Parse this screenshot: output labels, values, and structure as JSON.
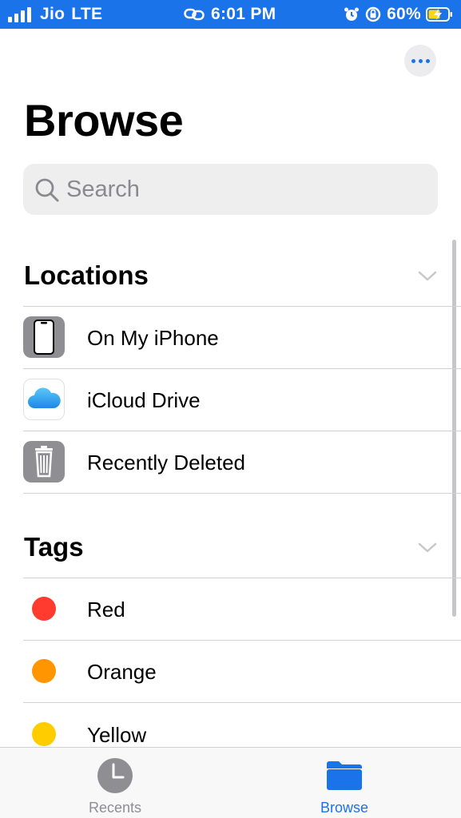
{
  "status_bar": {
    "carrier": "Jio",
    "network": "LTE",
    "time": "6:01 PM",
    "battery": "60%",
    "background_color": "#1a73e8"
  },
  "header": {
    "title": "Browse",
    "more_icon": "ellipsis-icon"
  },
  "search": {
    "placeholder": "Search",
    "value": ""
  },
  "locations": {
    "title": "Locations",
    "items": [
      {
        "label": "On My iPhone",
        "icon": "iphone-icon"
      },
      {
        "label": "iCloud Drive",
        "icon": "icloud-icon"
      },
      {
        "label": "Recently Deleted",
        "icon": "trash-icon"
      }
    ]
  },
  "tags": {
    "title": "Tags",
    "items": [
      {
        "label": "Red",
        "color": "#ff3b30"
      },
      {
        "label": "Orange",
        "color": "#ff9500"
      },
      {
        "label": "Yellow",
        "color": "#ffcc00"
      }
    ]
  },
  "tab_bar": {
    "tabs": [
      {
        "label": "Recents",
        "icon": "clock-icon",
        "active": false
      },
      {
        "label": "Browse",
        "icon": "folder-icon",
        "active": true
      }
    ],
    "active_color": "#1a73e8",
    "inactive_color": "#8e8e93"
  }
}
